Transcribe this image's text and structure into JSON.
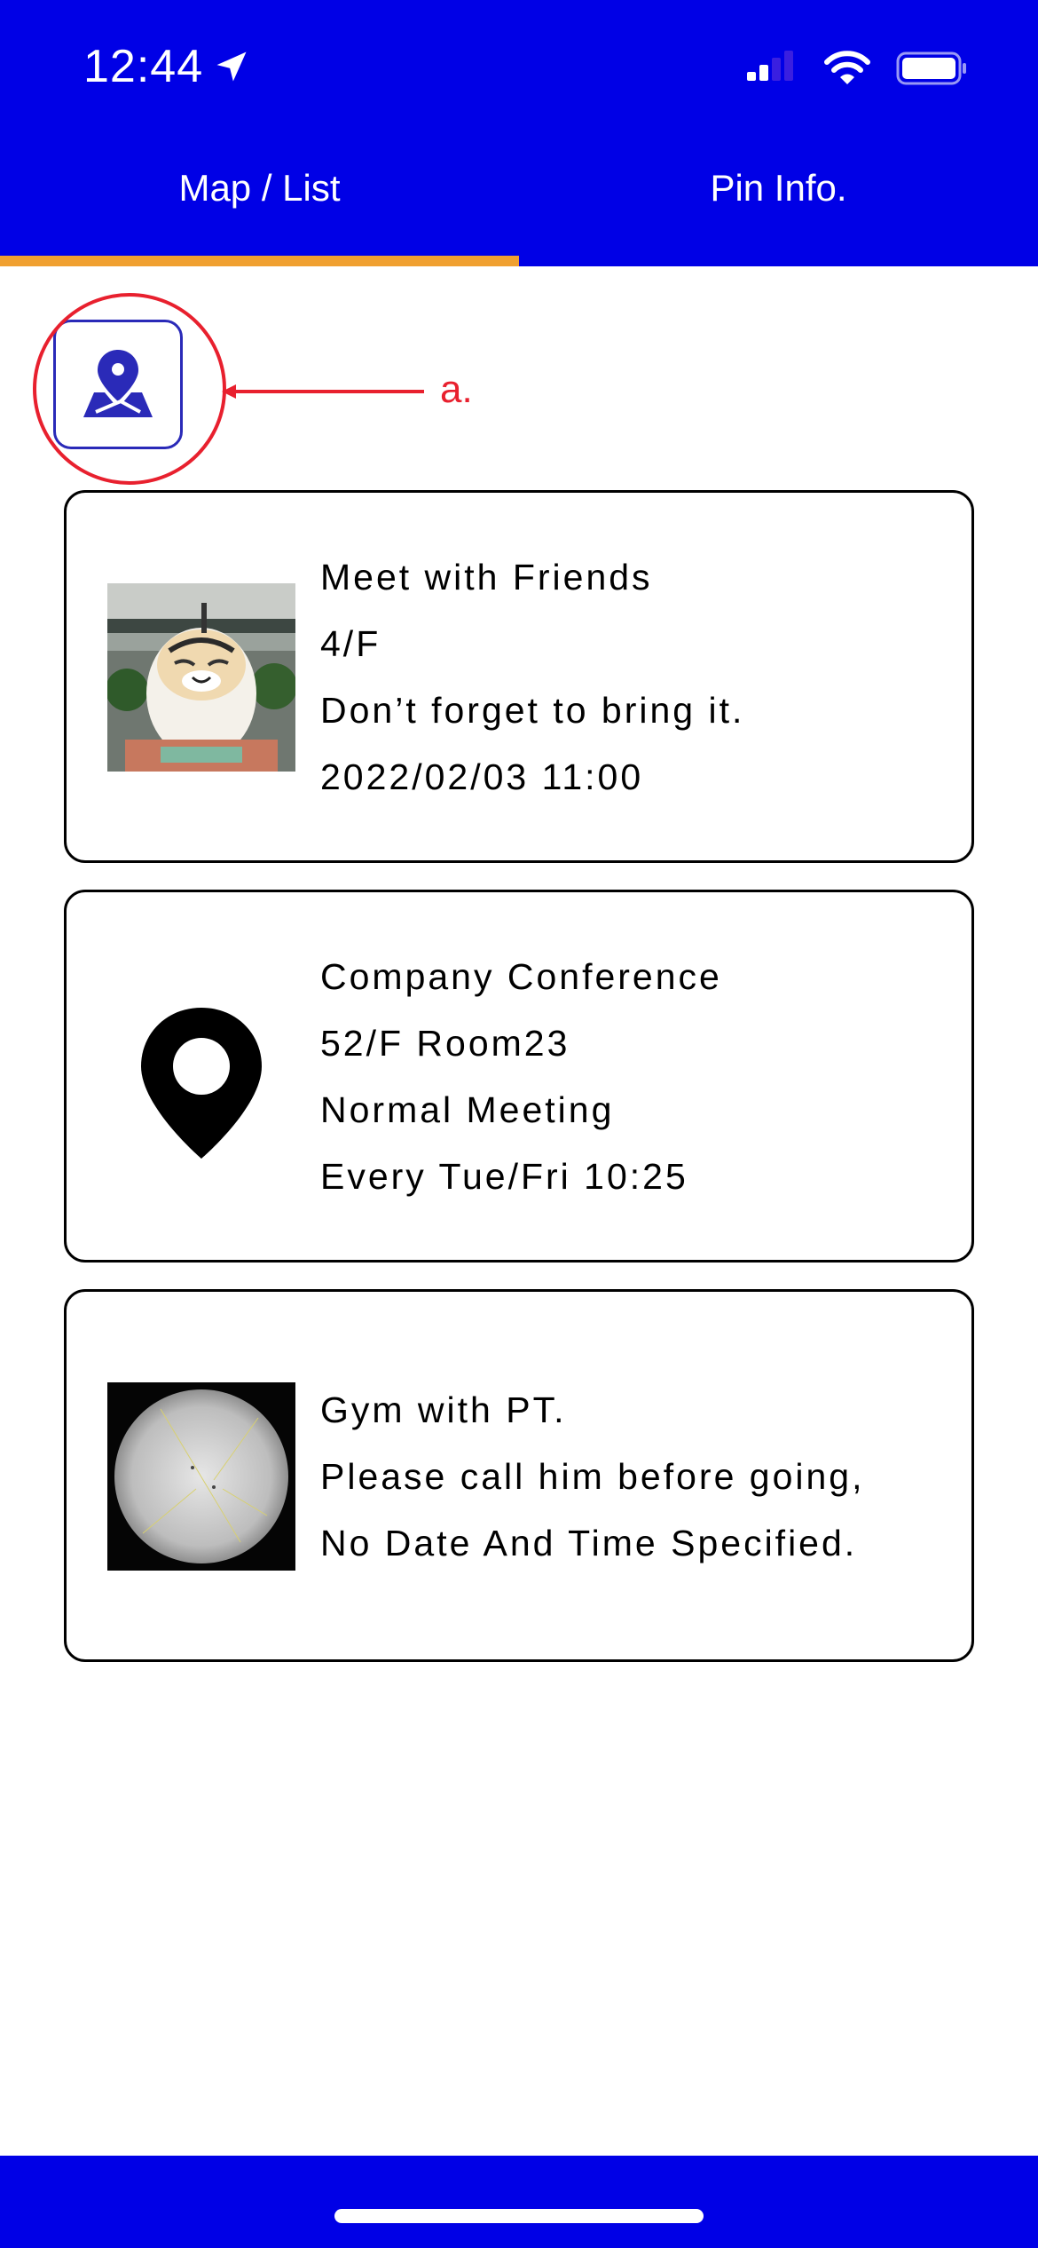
{
  "status_bar": {
    "time": "12:44",
    "icons": [
      "location-arrow-icon",
      "cellular-signal-icon",
      "wifi-icon",
      "battery-icon"
    ]
  },
  "tabs": [
    {
      "label": "Map / List",
      "selected": true
    },
    {
      "label": "Pin Info.",
      "selected": false
    }
  ],
  "colors": {
    "header_bg": "#0000e6",
    "tab_indicator": "#f0a030",
    "annotation": "#e8202e",
    "toggle_border": "#2a2ab8"
  },
  "map_toggle": {
    "icon": "map-pin-icon"
  },
  "annotation": {
    "label": "a."
  },
  "pins": [
    {
      "thumbnail": "photo-thumbnail",
      "lines": [
        "Meet with Friends",
        "4/F",
        "Don’t forget to bring it.",
        "2022/02/03 11:00"
      ]
    },
    {
      "thumbnail": "location-pin-icon",
      "lines": [
        "Company Conference",
        "52/F Room23",
        "Normal Meeting",
        "Every Tue/Fri 10:25"
      ]
    },
    {
      "thumbnail": "sun-photo-thumbnail",
      "lines": [
        "Gym with PT.",
        "Please call him before going,",
        "No Date And Time Specified."
      ]
    }
  ]
}
